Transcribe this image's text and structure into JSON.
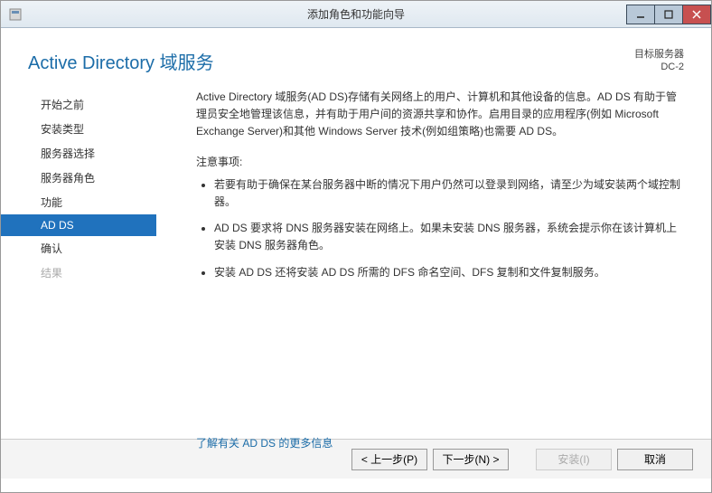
{
  "window": {
    "title": "添加角色和功能向导"
  },
  "header": {
    "page_title": "Active Directory 域服务",
    "target_label": "目标服务器",
    "target_value": "DC-2"
  },
  "sidebar": {
    "items": [
      {
        "label": "开始之前",
        "state": "normal"
      },
      {
        "label": "安装类型",
        "state": "normal"
      },
      {
        "label": "服务器选择",
        "state": "normal"
      },
      {
        "label": "服务器角色",
        "state": "normal"
      },
      {
        "label": "功能",
        "state": "normal"
      },
      {
        "label": "AD DS",
        "state": "selected"
      },
      {
        "label": "确认",
        "state": "normal"
      },
      {
        "label": "结果",
        "state": "disabled"
      }
    ]
  },
  "main": {
    "intro": "Active Directory 域服务(AD DS)存储有关网络上的用户、计算机和其他设备的信息。AD DS 有助于管理员安全地管理该信息，并有助于用户间的资源共享和协作。启用目录的应用程序(例如 Microsoft Exchange Server)和其他 Windows Server 技术(例如组策略)也需要 AD DS。",
    "note_label": "注意事项:",
    "bullets": [
      "若要有助于确保在某台服务器中断的情况下用户仍然可以登录到网络，请至少为域安装两个域控制器。",
      "AD DS 要求将 DNS 服务器安装在网络上。如果未安装 DNS 服务器，系统会提示你在该计算机上安装 DNS 服务器角色。",
      "安装 AD DS 还将安装 AD DS 所需的 DFS 命名空间、DFS 复制和文件复制服务。"
    ],
    "learn_more": "了解有关 AD DS 的更多信息"
  },
  "footer": {
    "prev": "< 上一步(P)",
    "next": "下一步(N) >",
    "install": "安装(I)",
    "cancel": "取消"
  }
}
